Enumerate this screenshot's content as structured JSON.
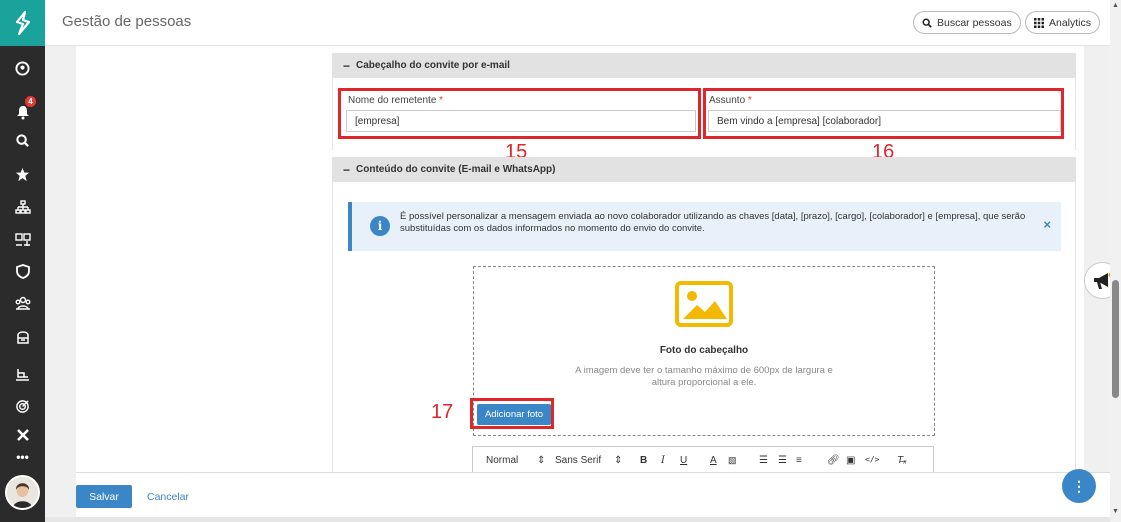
{
  "header": {
    "title": "Gestão de pessoas",
    "search_button": "Buscar pessoas",
    "analytics_button": "Analytics"
  },
  "sidebar": {
    "notification_count": "4",
    "icons": [
      "user-circle-icon",
      "bell-icon",
      "search-icon",
      "star-icon",
      "org-chart-icon",
      "people-icon",
      "shield-icon",
      "team-icon",
      "briefcase-icon",
      "training-icon",
      "target-icon",
      "x-icon",
      "more-icon"
    ]
  },
  "email_header_section": {
    "title": "Cabeçalho do convite por e-mail",
    "sender_label": "Nome do remetente",
    "sender_value": "[empresa]",
    "subject_label": "Assunto",
    "subject_value": "Bem vindo a [empresa] [colaborador]",
    "required_mark": "*"
  },
  "content_section": {
    "title": "Conteúdo do convite (E-mail e WhatsApp)",
    "info_text": "É possível personalizar a mensagem enviada ao novo colaborador utilizando as chaves [data], [prazo], [cargo], [colaborador] e [empresa], que serão substituídas com os dados informados no momento do envio do convite.",
    "photo_title": "Foto do cabeçalho",
    "photo_desc": "A imagem deve ter o tamanho máximo de 600px de largura e altura proporcional a ele.",
    "add_photo_button": "Adicionar foto",
    "toolbar": {
      "format": "Normal",
      "font": "Sans Serif"
    }
  },
  "annotations": {
    "n15": "15",
    "n16": "16",
    "n17": "17"
  },
  "footer": {
    "save_button": "Salvar",
    "cancel_link": "Cancelar"
  },
  "colors": {
    "brand_teal": "#1aa39a",
    "primary_blue": "#3b86c6",
    "annotation_red": "#e0252b",
    "sidebar_dark": "#2b2b2b"
  }
}
